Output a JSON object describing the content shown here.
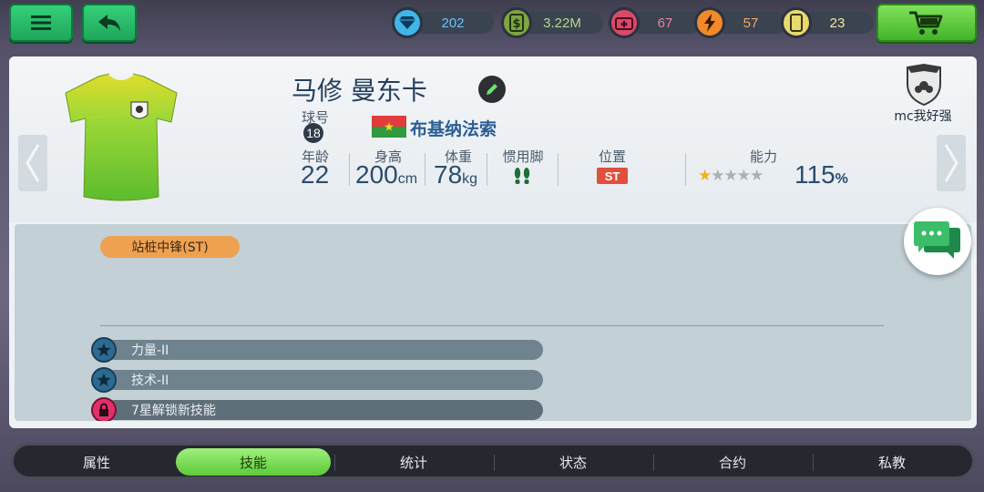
{
  "topbar": {
    "resources": [
      {
        "name": "diamond",
        "icon": "diamond-icon",
        "value": "202",
        "color": "#3fb6e8",
        "text_color": "#69c4ff"
      },
      {
        "name": "cash",
        "icon": "dollar-icon",
        "value": "3.22M",
        "color": "#7da640",
        "text_color": "#b8d58b"
      },
      {
        "name": "medkit",
        "icon": "medkit-icon",
        "value": "67",
        "color": "#d94a6a",
        "text_color": "#f07f9b"
      },
      {
        "name": "energy",
        "icon": "lightning-icon",
        "value": "57",
        "color": "#f08a2a",
        "text_color": "#f5a866"
      },
      {
        "name": "cards",
        "icon": "card-icon",
        "value": "23",
        "color": "#e7d96e",
        "text_color": "#f1e6a2"
      }
    ]
  },
  "player": {
    "name": "马修 曼东卡",
    "number_label": "球号",
    "number": "18",
    "country": "布基纳法索",
    "stats": [
      {
        "label": "年龄",
        "value": "22",
        "unit": ""
      },
      {
        "label": "身高",
        "value": "200",
        "unit": "cm"
      },
      {
        "label": "体重",
        "value": "78",
        "unit": "kg"
      },
      {
        "label": "惯用脚",
        "value": "",
        "unit": ""
      }
    ],
    "position_label": "位置",
    "position": "ST",
    "ability_label": "能力",
    "ability_stars": 1,
    "ability_stars_total": 5,
    "ability_value": "115",
    "ability_unit": "%",
    "club_name": "mc我好强"
  },
  "skills": {
    "role": "站桩中锋(ST)",
    "items": [
      {
        "label": "力量-II",
        "icon": "star-icon"
      },
      {
        "label": "技术-II",
        "icon": "star-icon"
      },
      {
        "label": "7星解锁新技能",
        "icon": "lock-icon"
      }
    ]
  },
  "tabs": [
    {
      "label": "属性",
      "active": false
    },
    {
      "label": "技能",
      "active": true
    },
    {
      "label": "统计",
      "active": false
    },
    {
      "label": "状态",
      "active": false
    },
    {
      "label": "合约",
      "active": false
    },
    {
      "label": "私教",
      "active": false
    }
  ]
}
